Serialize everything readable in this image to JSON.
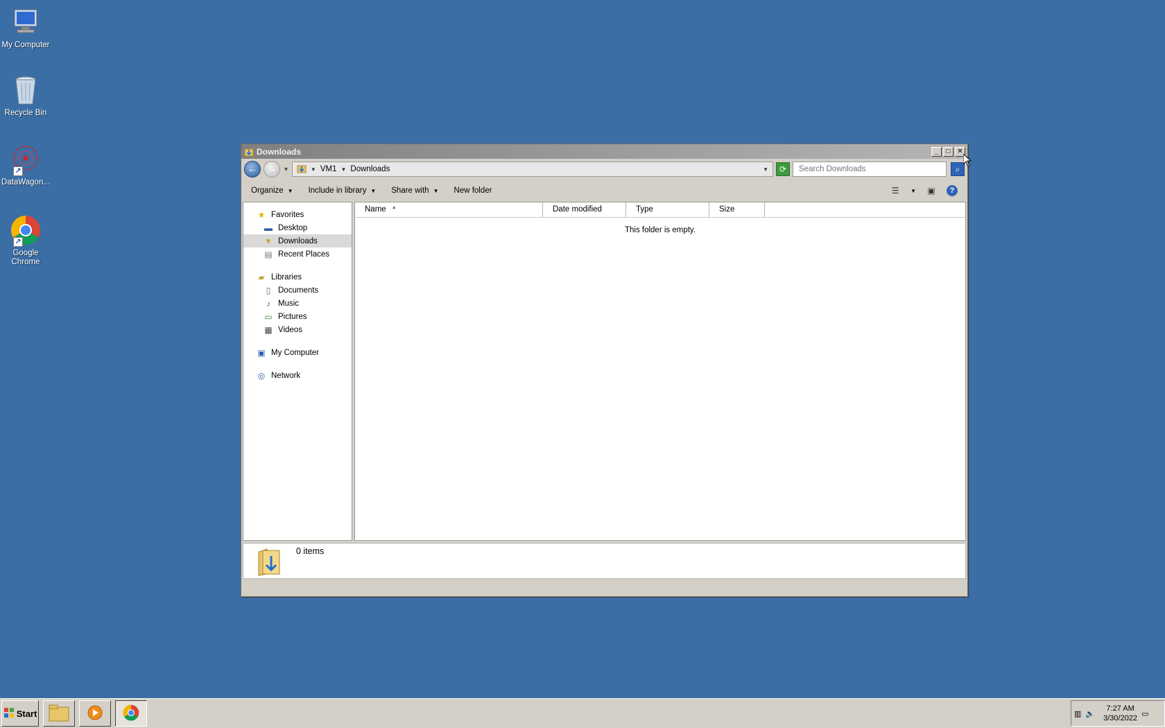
{
  "desktop": {
    "icons": [
      {
        "label": "My Computer"
      },
      {
        "label": "Recycle Bin"
      },
      {
        "label": "DataWagon..."
      },
      {
        "label": "Google Chrome"
      }
    ]
  },
  "window": {
    "title": "Downloads",
    "address": {
      "crumbs": [
        "VM1",
        "Downloads"
      ],
      "search_placeholder": "Search Downloads"
    },
    "toolbar": {
      "organize": "Organize",
      "include_in_library": "Include in library",
      "share_with": "Share with",
      "new_folder": "New folder"
    },
    "nav": {
      "favorites": {
        "label": "Favorites",
        "items": [
          "Desktop",
          "Downloads",
          "Recent Places"
        ]
      },
      "libraries": {
        "label": "Libraries",
        "items": [
          "Documents",
          "Music",
          "Pictures",
          "Videos"
        ]
      },
      "my_computer": "My Computer",
      "network": "Network"
    },
    "columns": [
      "Name",
      "Date modified",
      "Type",
      "Size"
    ],
    "empty_message": "This folder is empty.",
    "details": {
      "item_count": "0 items"
    }
  },
  "taskbar": {
    "start_label": "Start",
    "clock_time": "7:27 AM",
    "clock_date": "3/30/2022"
  }
}
